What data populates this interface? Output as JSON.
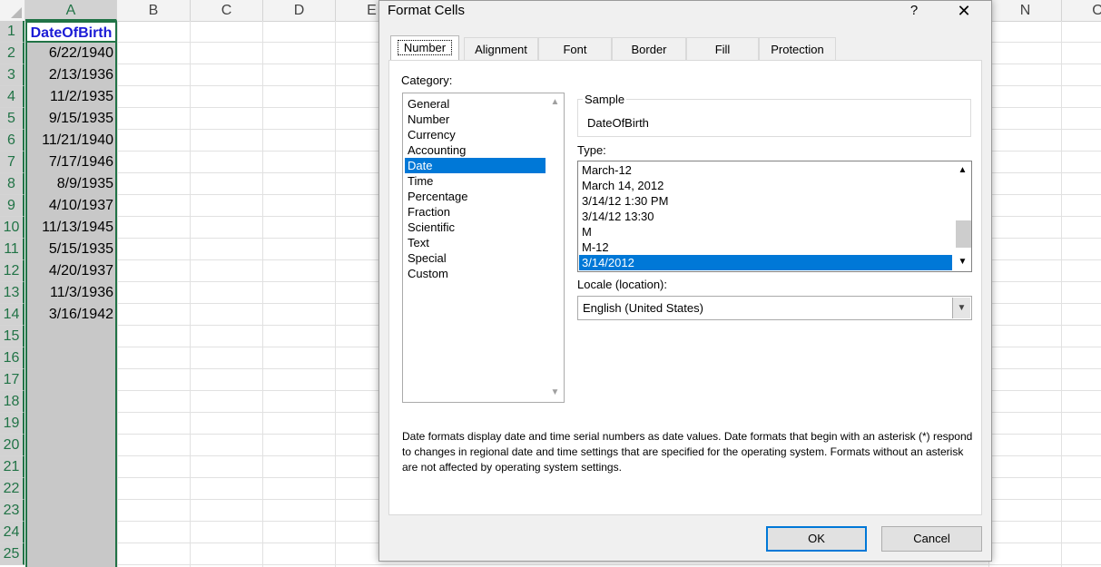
{
  "spreadsheet": {
    "columns": [
      "A",
      "B",
      "C",
      "D",
      "E",
      "N",
      "O"
    ],
    "rows": [
      "1",
      "2",
      "3",
      "4",
      "5",
      "6",
      "7",
      "8",
      "9",
      "10",
      "11",
      "12",
      "13",
      "14",
      "15",
      "16",
      "17",
      "18",
      "19",
      "20",
      "21",
      "22",
      "23",
      "24",
      "25"
    ],
    "header_cell": "DateOfBirth",
    "cells": [
      "6/22/1940",
      "2/13/1936",
      "11/2/1935",
      "9/15/1935",
      "11/21/1940",
      "7/17/1946",
      "8/9/1935",
      "4/10/1937",
      "11/13/1945",
      "5/15/1935",
      "4/20/1937",
      "11/3/1936",
      "3/16/1942"
    ]
  },
  "dialog": {
    "title": "Format Cells",
    "help": "?",
    "close": "✕",
    "tabs": [
      "Number",
      "Alignment",
      "Font",
      "Border",
      "Fill",
      "Protection"
    ],
    "active_tab": "Number",
    "category_label": "Category:",
    "categories": [
      "General",
      "Number",
      "Currency",
      "Accounting",
      "Date",
      "Time",
      "Percentage",
      "Fraction",
      "Scientific",
      "Text",
      "Special",
      "Custom"
    ],
    "selected_category": "Date",
    "sample_label": "Sample",
    "sample_value": "DateOfBirth",
    "type_label": "Type:",
    "types": [
      "March-12",
      "March 14, 2012",
      "3/14/12 1:30 PM",
      "3/14/12 13:30",
      "M",
      "M-12",
      "3/14/2012"
    ],
    "selected_type": "3/14/2012",
    "locale_label": "Locale (location):",
    "locale_value": "English (United States)",
    "description": "Date formats display date and time serial numbers as date values.  Date formats that begin with an asterisk (*) respond to changes in regional date and time settings that are specified for the operating system. Formats without an asterisk are not affected by operating system settings.",
    "ok_label": "OK",
    "cancel_label": "Cancel"
  },
  "colors": {
    "selection_green": "#217346",
    "header_blue": "#1b1bd6",
    "list_selection": "#0078d7"
  }
}
